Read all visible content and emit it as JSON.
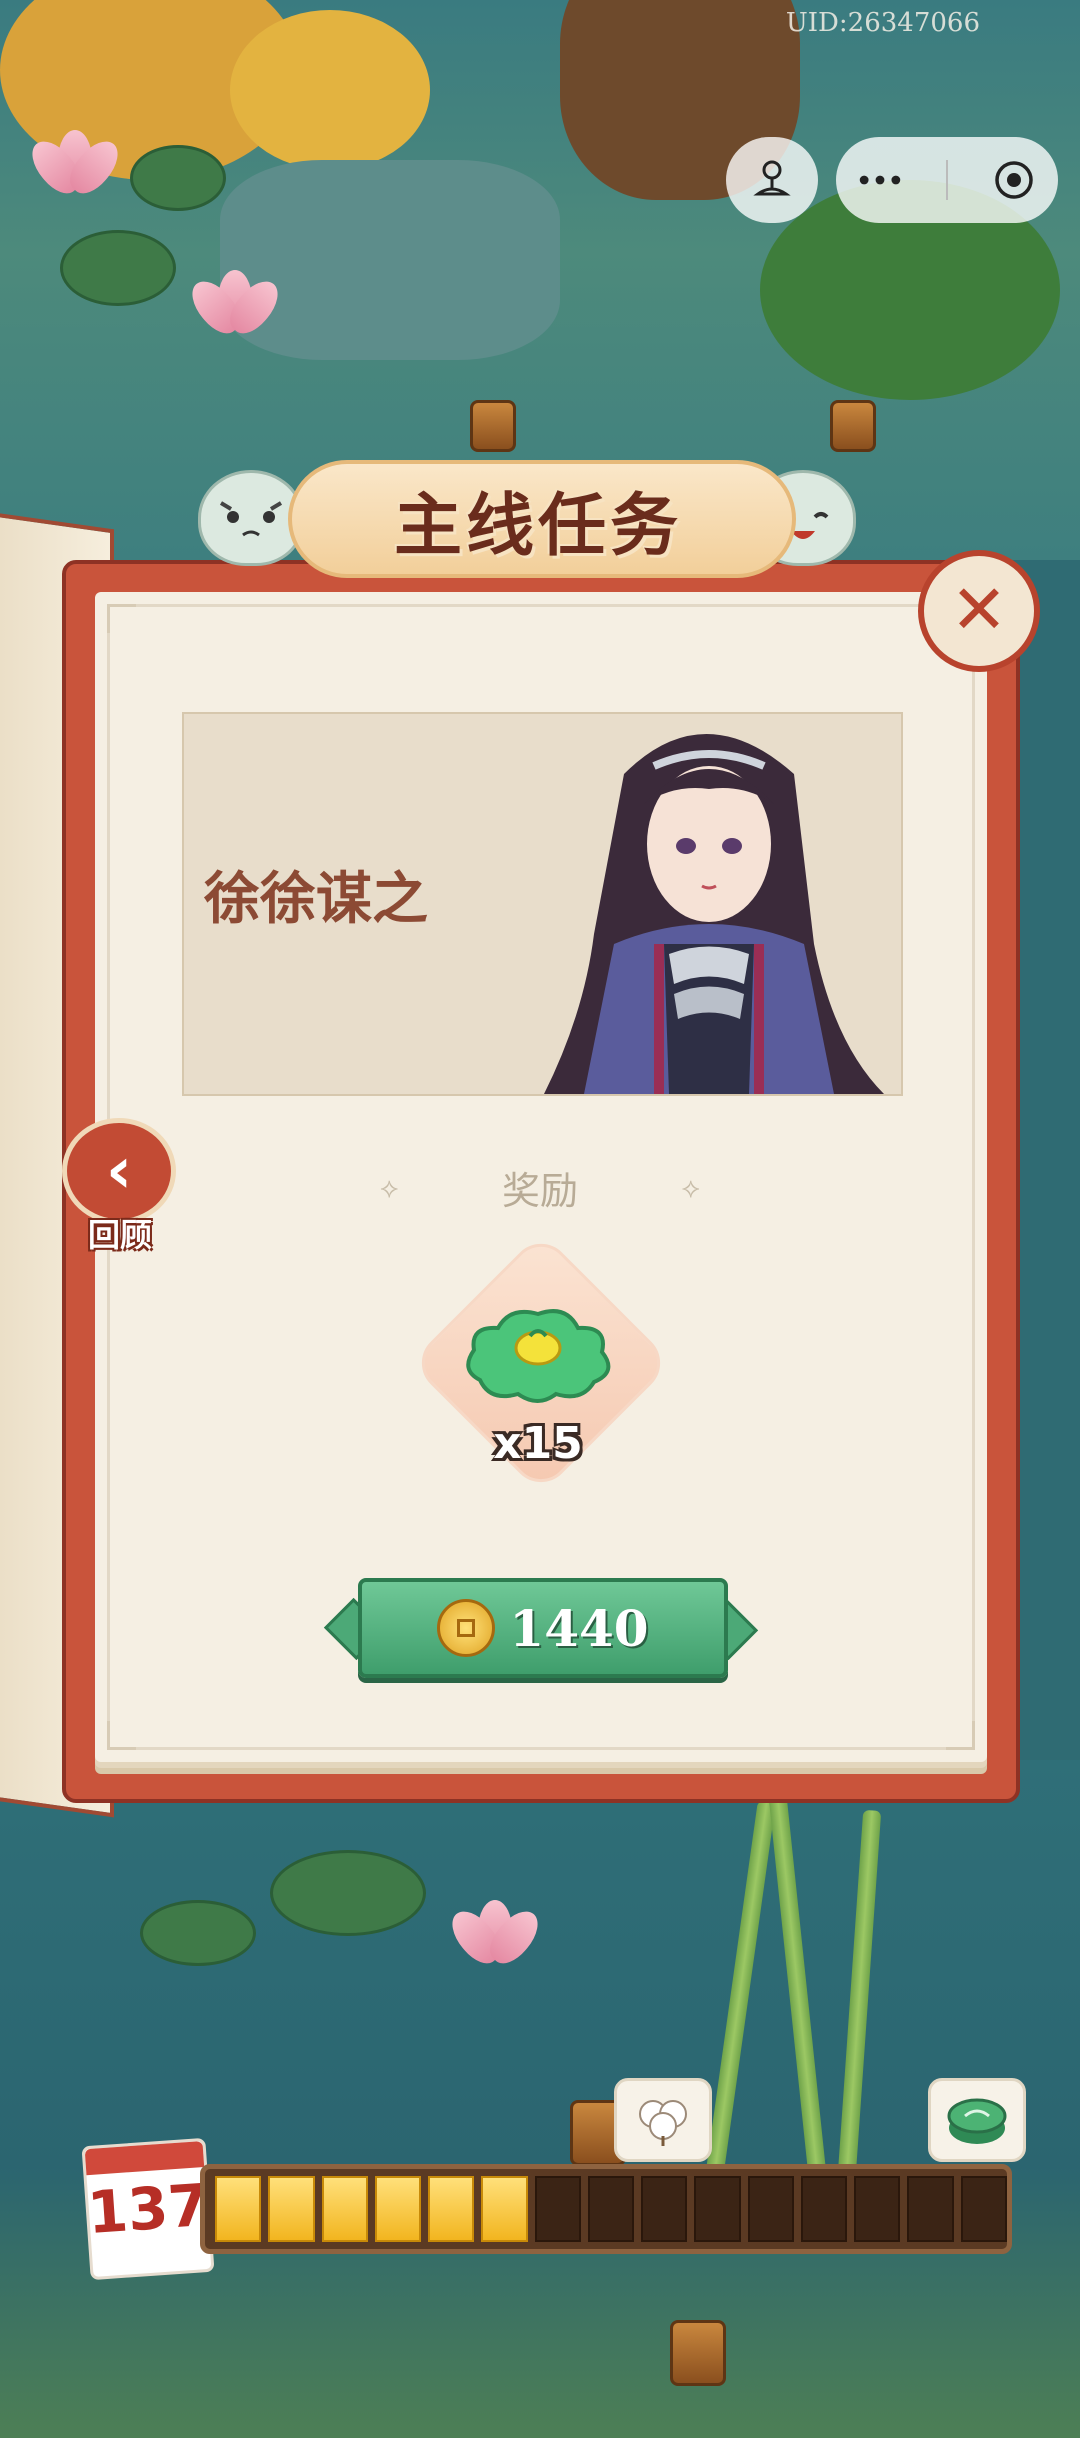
{
  "uid": "UID:26347066",
  "capsule": {
    "left_icon": "game-center-icon",
    "more_icon": "more-dots-icon",
    "record_icon": "target-icon"
  },
  "panel": {
    "title": "主线任务",
    "chapter_name": "徐徐谋之"
  },
  "close_icon": "close-x-icon",
  "back": {
    "label": "回顾",
    "icon": "chevron-left-icon"
  },
  "reward": {
    "header": "奖励",
    "item_icon": "green-cloud-icon",
    "quantity": "x15"
  },
  "cost": {
    "icon": "copper-coin-icon",
    "value": "1440"
  },
  "progress": {
    "day": "137",
    "segments_total": 15,
    "segments_filled": 6,
    "milestone_icons": [
      "cotton-icon",
      "green-tin-icon"
    ]
  },
  "colors": {
    "accent_red": "#c9543b",
    "button_green": "#4ca977",
    "paper": "#f5efe3",
    "title_brown": "#6a2c1c"
  }
}
